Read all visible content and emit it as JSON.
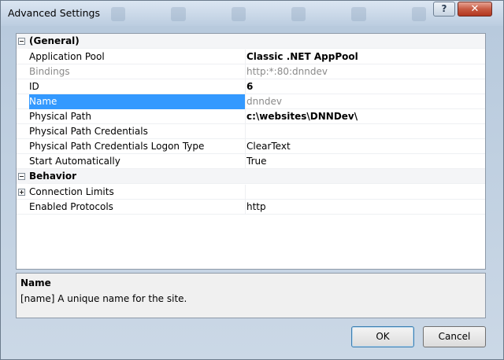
{
  "window": {
    "title": "Advanced Settings",
    "help_label": "?",
    "close_label": "✕"
  },
  "grid": {
    "categories": {
      "general": "(General)",
      "behavior": "Behavior"
    },
    "rows": [
      {
        "name": "Application Pool",
        "value": "Classic .NET AppPool"
      },
      {
        "name": "Bindings",
        "value": "http:*:80:dnndev"
      },
      {
        "name": "ID",
        "value": "6"
      },
      {
        "name": "Name",
        "value": "dnndev"
      },
      {
        "name": "Physical Path",
        "value": "c:\\websites\\DNNDev\\"
      },
      {
        "name": "Physical Path Credentials",
        "value": ""
      },
      {
        "name": "Physical Path Credentials Logon Type",
        "value": "ClearText"
      },
      {
        "name": "Start Automatically",
        "value": "True"
      },
      {
        "name": "Connection Limits",
        "value": ""
      },
      {
        "name": "Enabled Protocols",
        "value": "http"
      }
    ],
    "selected_row": "Name"
  },
  "description": {
    "title": "Name",
    "text": "[name] A unique name for the site."
  },
  "buttons": {
    "ok": "OK",
    "cancel": "Cancel"
  }
}
